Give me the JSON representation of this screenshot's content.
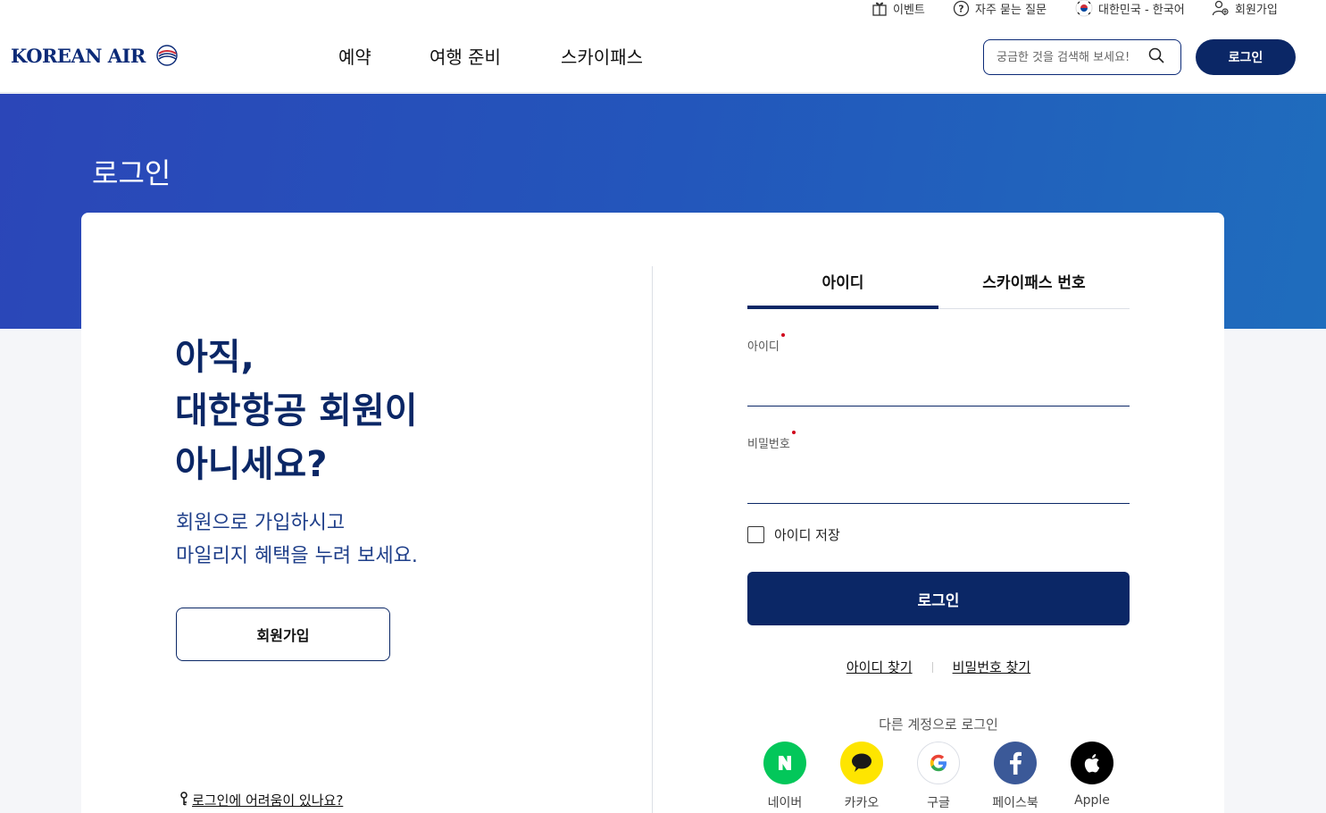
{
  "utility": {
    "event": "이벤트",
    "faq": "자주 묻는 질문",
    "language": "대한민국 - 한국어",
    "signup": "회원가입"
  },
  "header": {
    "logo": "KOREAN AIR",
    "nav": [
      "예약",
      "여행 준비",
      "스카이패스"
    ],
    "search_placeholder": "궁금한 것을 검색해 보세요!",
    "login_label": "로그인"
  },
  "hero": {
    "title": "로그인"
  },
  "promo": {
    "title_lines": [
      "아직,",
      "대한항공 회원이",
      "아니세요?"
    ],
    "sub_lines": [
      "회원으로 가입하시고",
      "마일리지 혜택을 누려 보세요."
    ],
    "join_label": "회원가입",
    "help_label": "로그인에 어려움이 있나요?"
  },
  "login_form": {
    "tabs": [
      "아이디",
      "스카이패스 번호"
    ],
    "active_tab": 0,
    "id_label": "아이디",
    "id_value": "",
    "password_label": "비밀번호",
    "password_value": "",
    "remember_label": "아이디 저장",
    "remember_checked": false,
    "submit_label": "로그인",
    "find_id": "아이디 찾기",
    "find_password": "비밀번호 찾기"
  },
  "social": {
    "title": "다른 계정으로 로그인",
    "items": [
      {
        "label": "네이버",
        "icon": "naver-icon",
        "color": "#03c75a"
      },
      {
        "label": "카카오",
        "icon": "kakao-icon",
        "color": "#fee500"
      },
      {
        "label": "구글",
        "icon": "google-icon",
        "color": "#ffffff"
      },
      {
        "label": "페이스북",
        "icon": "facebook-icon",
        "color": "#3b5998"
      },
      {
        "label": "Apple",
        "icon": "apple-icon",
        "color": "#000000"
      }
    ]
  },
  "colors": {
    "brand_navy": "#0b2766",
    "hero_blue": "#2b46b8",
    "required_dot": "#d0021b"
  }
}
